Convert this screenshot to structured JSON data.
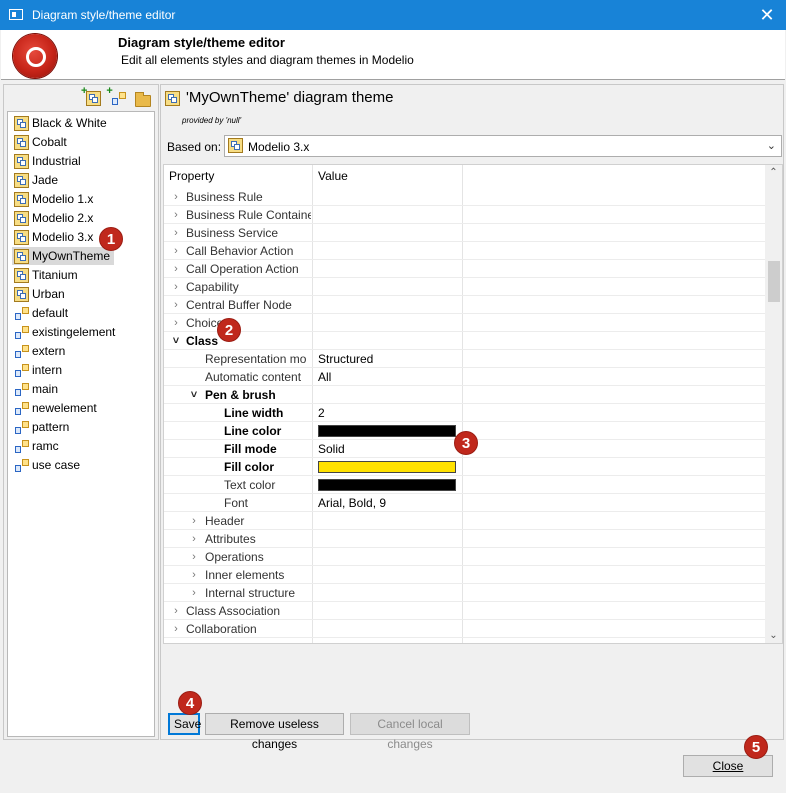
{
  "window": {
    "title": "Diagram style/theme editor",
    "close_glyph": "✕"
  },
  "banner": {
    "title": "Diagram style/theme editor",
    "subtitle": "Edit all elements styles and diagram themes in Modelio"
  },
  "themes_toolbar": {
    "icons": [
      "new-theme-icon",
      "new-style-icon",
      "open-folder-icon"
    ]
  },
  "themes_tree": {
    "items": [
      {
        "label": "Black & White",
        "kind": "theme"
      },
      {
        "label": "Cobalt",
        "kind": "theme"
      },
      {
        "label": "Industrial",
        "kind": "theme"
      },
      {
        "label": "Jade",
        "kind": "theme"
      },
      {
        "label": "Modelio 1.x",
        "kind": "theme"
      },
      {
        "label": "Modelio 2.x",
        "kind": "theme"
      },
      {
        "label": "Modelio 3.x",
        "kind": "theme"
      },
      {
        "label": "MyOwnTheme",
        "kind": "theme",
        "selected": true
      },
      {
        "label": "Titanium",
        "kind": "theme"
      },
      {
        "label": "Urban",
        "kind": "theme"
      },
      {
        "label": "default",
        "kind": "style"
      },
      {
        "label": "existingelement",
        "kind": "style"
      },
      {
        "label": "extern",
        "kind": "style"
      },
      {
        "label": "intern",
        "kind": "style"
      },
      {
        "label": "main",
        "kind": "style"
      },
      {
        "label": "newelement",
        "kind": "style"
      },
      {
        "label": "pattern",
        "kind": "style"
      },
      {
        "label": "ramc",
        "kind": "style"
      },
      {
        "label": "use case",
        "kind": "style"
      }
    ]
  },
  "editor": {
    "heading": "'MyOwnTheme' diagram theme",
    "provided_by": "provided by 'null'",
    "based_on_label": "Based on:",
    "based_on_value": "Modelio 3.x"
  },
  "properties": {
    "col_property": "Property",
    "col_value": "Value",
    "rows": [
      {
        "name": "Business Rule",
        "level": 0,
        "toggle": "closed"
      },
      {
        "name": "Business Rule Containe",
        "level": 0,
        "toggle": "closed"
      },
      {
        "name": "Business Service",
        "level": 0,
        "toggle": "closed"
      },
      {
        "name": "Call Behavior Action",
        "level": 0,
        "toggle": "closed"
      },
      {
        "name": "Call Operation Action",
        "level": 0,
        "toggle": "closed"
      },
      {
        "name": "Capability",
        "level": 0,
        "toggle": "closed"
      },
      {
        "name": "Central Buffer Node",
        "level": 0,
        "toggle": "closed"
      },
      {
        "name": "Choice",
        "level": 0,
        "toggle": "closed"
      },
      {
        "name": "Class",
        "level": 0,
        "toggle": "open",
        "bold": true
      },
      {
        "name": "Representation mo",
        "level": 1,
        "value": "Structured"
      },
      {
        "name": "Automatic content",
        "level": 1,
        "value": "All"
      },
      {
        "name": "Pen & brush",
        "level": 1,
        "toggle": "open",
        "bold": true
      },
      {
        "name": "Line width",
        "level": 2,
        "value": "2",
        "bold": true
      },
      {
        "name": "Line color",
        "level": 2,
        "swatch": "#000000",
        "bold": true
      },
      {
        "name": "Fill mode",
        "level": 2,
        "value": "Solid",
        "bold": true
      },
      {
        "name": "Fill color",
        "level": 2,
        "swatch": "#ffe100",
        "bold": true
      },
      {
        "name": "Text color",
        "level": 2,
        "swatch": "#000000"
      },
      {
        "name": "Font",
        "level": 2,
        "value": "Arial, Bold, 9"
      },
      {
        "name": "Header",
        "level": 1,
        "toggle": "closed"
      },
      {
        "name": "Attributes",
        "level": 1,
        "toggle": "closed"
      },
      {
        "name": "Operations",
        "level": 1,
        "toggle": "closed"
      },
      {
        "name": "Inner elements",
        "level": 1,
        "toggle": "closed"
      },
      {
        "name": "Internal structure",
        "level": 1,
        "toggle": "closed"
      },
      {
        "name": "Class Association",
        "level": 0,
        "toggle": "closed"
      },
      {
        "name": "Collaboration",
        "level": 0,
        "toggle": "closed"
      }
    ]
  },
  "buttons": {
    "save": "Save",
    "remove_useless": "Remove useless changes",
    "cancel_local": "Cancel local changes",
    "close": "Close"
  },
  "markers": [
    "1",
    "2",
    "3",
    "4",
    "5"
  ],
  "colors": {
    "titlebar": "#1883d7",
    "marker": "#c0281c",
    "selection": "#d9d9d9"
  }
}
